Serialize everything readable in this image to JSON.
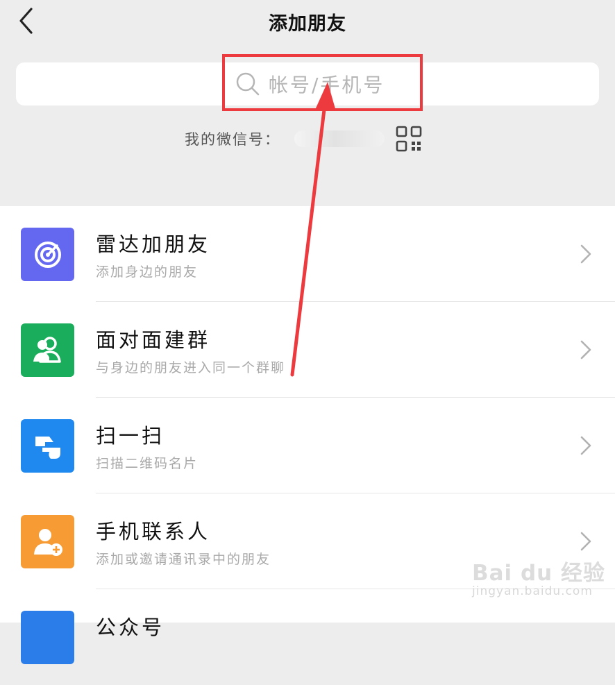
{
  "header": {
    "title": "添加朋友",
    "back_icon": "chevron-left-icon"
  },
  "search": {
    "placeholder": "帐号/手机号",
    "icon": "search-icon"
  },
  "my_id": {
    "label": "我的微信号：",
    "qr_icon": "qr-code-icon"
  },
  "list": {
    "items": [
      {
        "title": "雷达加朋友",
        "subtitle": "添加身边的朋友",
        "icon": "radar-icon",
        "color": "#6467ef"
      },
      {
        "title": "面对面建群",
        "subtitle": "与身边的朋友进入同一个群聊",
        "icon": "group-icon",
        "color": "#1aad5c"
      },
      {
        "title": "扫一扫",
        "subtitle": "扫描二维码名片",
        "icon": "scan-icon",
        "color": "#1f89f0"
      },
      {
        "title": "手机联系人",
        "subtitle": "添加或邀请通讯录中的朋友",
        "icon": "contact-add-icon",
        "color": "#f79b35"
      },
      {
        "title": "公众号",
        "subtitle": "",
        "icon": "official-account-icon",
        "color": "#2b7de9"
      }
    ]
  },
  "annotation": {
    "color": "#ec3a3f"
  },
  "watermark": {
    "logo": "Bai du 经验",
    "url": "jingyan.baidu.com"
  }
}
